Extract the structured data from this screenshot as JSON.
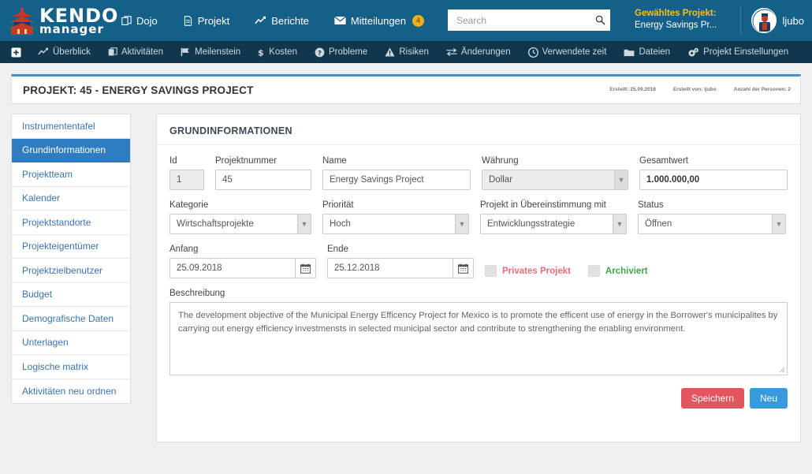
{
  "brand": {
    "line1": "KENDO",
    "line2": "manager",
    "logo_icon": "pagoda-logo-icon"
  },
  "topnav": [
    {
      "label": "Dojo",
      "icon": "copy-icon"
    },
    {
      "label": "Projekt",
      "icon": "file-icon"
    },
    {
      "label": "Berichte",
      "icon": "chart-line-icon"
    },
    {
      "label": "Mitteilungen",
      "icon": "envelope-icon",
      "badge": "4"
    }
  ],
  "search": {
    "placeholder": "Search",
    "value": "",
    "icon": "search-icon"
  },
  "selected_project": {
    "label": "Gewähltes Projekt:",
    "value": "Energy Savings Pr..."
  },
  "user": {
    "name": "ljubo",
    "avatar_icon": "user-avatar-icon"
  },
  "subnav": [
    {
      "label": "",
      "icon": "plus-square-icon"
    },
    {
      "label": "Überblick",
      "icon": "chart-line-icon"
    },
    {
      "label": "Aktivitäten",
      "icon": "copy-icon"
    },
    {
      "label": "Meilenstein",
      "icon": "flag-icon"
    },
    {
      "label": "Kosten",
      "icon": "dollar-icon"
    },
    {
      "label": "Probleme",
      "icon": "question-circle-icon"
    },
    {
      "label": "Risiken",
      "icon": "warning-triangle-icon"
    },
    {
      "label": "Änderungen",
      "icon": "exchange-icon"
    },
    {
      "label": "Verwendete zeit",
      "icon": "clock-icon"
    },
    {
      "label": "Dateien",
      "icon": "folder-icon"
    },
    {
      "label": "Projekt Einstellungen",
      "icon": "gears-icon"
    }
  ],
  "page_title": "PROJEKT: 45 - ENERGY SAVINGS PROJECT",
  "page_meta": [
    "Erstellt: 25.09.2018",
    "Erstellt von: ljubo",
    "Anzahl der Personen: 2"
  ],
  "sidebar": {
    "items": [
      {
        "label": "Instrumententafel",
        "active": false
      },
      {
        "label": "Grundinformationen",
        "active": true
      },
      {
        "label": "Projektteam",
        "active": false
      },
      {
        "label": "Kalender",
        "active": false
      },
      {
        "label": "Projektstandorte",
        "active": false
      },
      {
        "label": "Projekteigentümer",
        "active": false
      },
      {
        "label": "Projektzielbenutzer",
        "active": false
      },
      {
        "label": "Budget",
        "active": false
      },
      {
        "label": "Demografische Daten",
        "active": false
      },
      {
        "label": "Unterlagen",
        "active": false
      },
      {
        "label": "Logische matrix",
        "active": false
      },
      {
        "label": "Aktivitäten neu ordnen",
        "active": false
      }
    ]
  },
  "panel": {
    "heading": "GRUNDINFORMATIONEN",
    "fields": {
      "id": {
        "label": "Id",
        "value": "1"
      },
      "projektnummer": {
        "label": "Projektnummer",
        "value": "45"
      },
      "name": {
        "label": "Name",
        "value": "Energy Savings Project"
      },
      "waehrung": {
        "label": "Währung",
        "value": "Dollar"
      },
      "gesamtwert": {
        "label": "Gesamtwert",
        "value": "1.000.000,00"
      },
      "kategorie": {
        "label": "Kategorie",
        "value": "Wirtschaftsprojekte"
      },
      "prioritaet": {
        "label": "Priorität",
        "value": "Hoch"
      },
      "strategie": {
        "label": "Projekt in Übereinstimmung mit",
        "value": "Entwicklungsstrategie"
      },
      "status": {
        "label": "Status",
        "value": "Öffnen"
      },
      "anfang": {
        "label": "Anfang",
        "value": "25.09.2018",
        "icon": "calendar-icon"
      },
      "ende": {
        "label": "Ende",
        "value": "25.12.2018",
        "icon": "calendar-icon"
      },
      "privat": {
        "label": "Privates Projekt",
        "checked": false,
        "color": "#f1697a"
      },
      "archiviert": {
        "label": "Archiviert",
        "checked": false,
        "color": "#3ca84b"
      },
      "beschreibung": {
        "label": "Beschreibung",
        "value": "The development objective of the Municipal Energy Efficency Project for Mexico is to promote the efficent use of energy in the Borrower's municipalites by carrying out energy efficiency investmensts in selected municipal sector and contribute to strengthening the enabling environment."
      }
    },
    "buttons": {
      "save": "Speichern",
      "new": "Neu"
    }
  },
  "colors": {
    "topbar": "#146089",
    "subnav": "#11374f",
    "accent_blue": "#2f7dc0",
    "save_red": "#e2565f",
    "new_blue": "#389ada",
    "yellow": "#f0c419"
  }
}
